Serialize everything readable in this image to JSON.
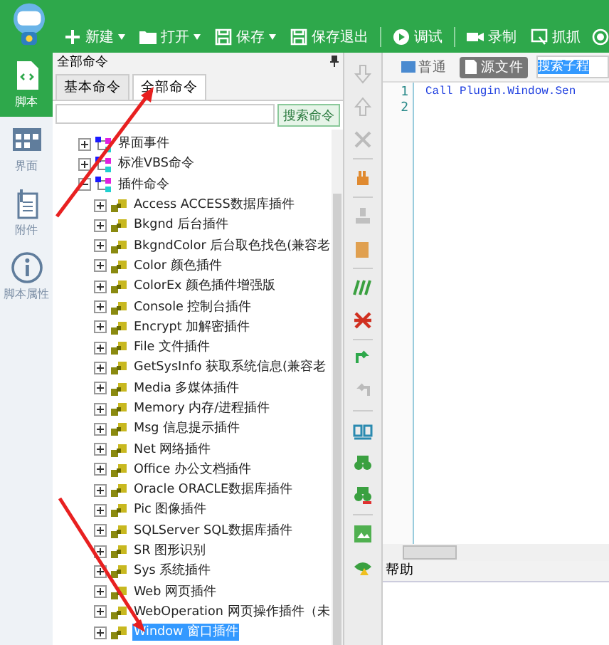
{
  "toolbar": [
    {
      "label": "新建"
    },
    {
      "label": "打开"
    },
    {
      "label": "保存"
    },
    {
      "label": "保存退出"
    },
    {
      "label": "调试"
    },
    {
      "label": "录制"
    },
    {
      "label": "抓抓"
    }
  ],
  "sidebar": {
    "items": [
      {
        "label": "脚本",
        "selected": true
      },
      {
        "label": "界面",
        "selected": false
      },
      {
        "label": "附件",
        "selected": false
      },
      {
        "label": "脚本属性",
        "selected": false
      }
    ]
  },
  "command_panel": {
    "title": "全部命令",
    "tabs": [
      {
        "label": "基本命令",
        "selected": false
      },
      {
        "label": "全部命令",
        "selected": true
      }
    ],
    "search_button": "搜索命令",
    "tree": [
      {
        "label": "界面事件",
        "expanded": false
      },
      {
        "label": "标准VBS命令",
        "expanded": false
      },
      {
        "label": "插件命令",
        "expanded": true,
        "children": [
          {
            "label": "Access ACCESS数据库插件",
            "selected": false
          },
          {
            "label": "Bkgnd 后台插件",
            "selected": false
          },
          {
            "label": "BkgndColor 后台取色找色(兼容老",
            "selected": false
          },
          {
            "label": "Color 颜色插件",
            "selected": false
          },
          {
            "label": "ColorEx 颜色插件增强版",
            "selected": false
          },
          {
            "label": "Console 控制台插件",
            "selected": false
          },
          {
            "label": "Encrypt 加解密插件",
            "selected": false
          },
          {
            "label": "File 文件插件",
            "selected": false
          },
          {
            "label": "GetSysInfo 获取系统信息(兼容老",
            "selected": false
          },
          {
            "label": "Media 多媒体插件",
            "selected": false
          },
          {
            "label": "Memory 内存/进程插件",
            "selected": false
          },
          {
            "label": "Msg 信息提示插件",
            "selected": false
          },
          {
            "label": "Net 网络插件",
            "selected": false
          },
          {
            "label": "Office 办公文档插件",
            "selected": false
          },
          {
            "label": "Oracle ORACLE数据库插件",
            "selected": false
          },
          {
            "label": "Pic 图像插件",
            "selected": false
          },
          {
            "label": "SQLServer SQL数据库插件",
            "selected": false
          },
          {
            "label": "SR 图形识别",
            "selected": false
          },
          {
            "label": "Sys 系统插件",
            "selected": false
          },
          {
            "label": "Web 网页插件",
            "selected": false
          },
          {
            "label": "WebOperation 网页操作插件（未",
            "selected": false
          },
          {
            "label": "Window 窗口插件",
            "selected": true
          }
        ]
      }
    ]
  },
  "editor": {
    "modes": [
      {
        "label": "普通",
        "selected": false
      },
      {
        "label": "源文件",
        "selected": true
      }
    ],
    "search_value": "搜索子程",
    "lines": [
      {
        "number": "1",
        "code": "Call Plugin.Window.Sen"
      },
      {
        "number": "2"
      }
    ]
  },
  "help_panel": {
    "title": "帮助"
  }
}
